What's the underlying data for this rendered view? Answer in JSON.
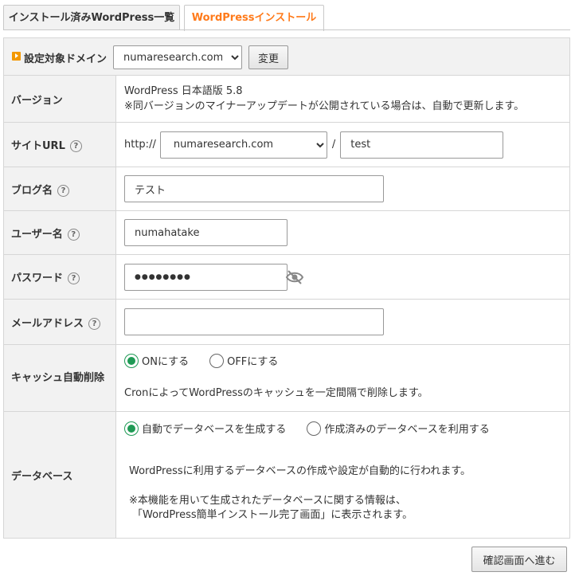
{
  "tabs": [
    {
      "label": "インストール済みWordPress一覧"
    },
    {
      "label": "WordPressインストール"
    }
  ],
  "domain": {
    "label": "設定対象ドメイン",
    "selected": "numaresearch.com",
    "change_button": "変更"
  },
  "rows": {
    "version": {
      "label": "バージョン",
      "value": "WordPress 日本語版 5.8",
      "note": "※同バージョンのマイナーアップデートが公開されている場合は、自動で更新します。"
    },
    "site_url": {
      "label": "サイトURL",
      "prefix": "http://",
      "domain": "numaresearch.com",
      "slash": "/",
      "path": "test"
    },
    "blog_name": {
      "label": "ブログ名",
      "value": "テスト"
    },
    "username": {
      "label": "ユーザー名",
      "value": "numahatake"
    },
    "password": {
      "label": "パスワード",
      "value": "●●●●●●●●"
    },
    "email": {
      "label": "メールアドレス",
      "value": ""
    },
    "cache": {
      "label": "キャッシュ自動削除",
      "on_label": "ONにする",
      "off_label": "OFFにする",
      "selected": "on",
      "note": "CronによってWordPressのキャッシュを一定間隔で削除します。"
    },
    "database": {
      "label": "データベース",
      "auto_label": "自動でデータベースを生成する",
      "existing_label": "作成済みのデータベースを利用する",
      "selected": "auto",
      "note1": "WordPressに利用するデータベースの作成や設定が自動的に行われます。",
      "note2": "※本機能を用いて生成されたデータベースに関する情報は、",
      "note3": "「WordPress簡単インストール完了画面」に表示されます。"
    }
  },
  "help_glyph": "?",
  "submit_button": "確認画面へ進む",
  "colors": {
    "accent": "#ff7a1a",
    "radio_on": "#1f9a55",
    "header_bg": "#f2f2f2",
    "border": "#d6d6d6"
  }
}
